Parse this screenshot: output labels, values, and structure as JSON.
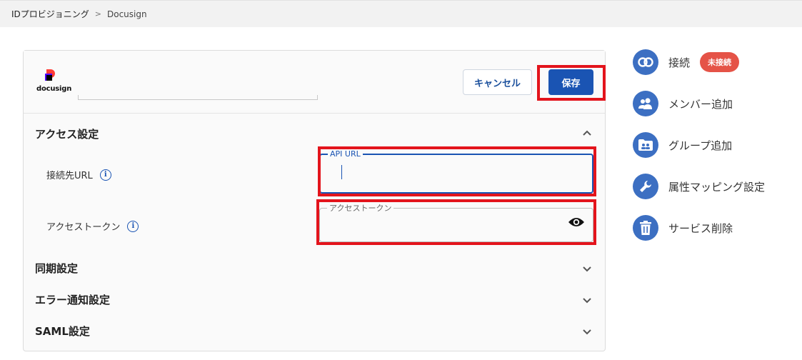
{
  "breadcrumb": {
    "root": "IDプロビジョニング",
    "separator": ">",
    "current": "Docusign"
  },
  "logo": {
    "text": "docusign"
  },
  "header": {
    "cancel_label": "キャンセル",
    "save_label": "保存"
  },
  "access_section": {
    "title": "アクセス設定",
    "url_row": {
      "label": "接続先URL",
      "field_legend": "API URL",
      "value": ""
    },
    "token_row": {
      "label": "アクセストークン",
      "field_legend": "アクセストークン",
      "value": ""
    }
  },
  "collapsed_sections": [
    {
      "title": "同期設定"
    },
    {
      "title": "エラー通知設定"
    },
    {
      "title": "SAML設定"
    }
  ],
  "sidebar": {
    "items": [
      {
        "label": "接続",
        "icon": "link-icon",
        "badge": "未接続"
      },
      {
        "label": "メンバー追加",
        "icon": "users-icon"
      },
      {
        "label": "グループ追加",
        "icon": "group-folder-icon"
      },
      {
        "label": "属性マッピング設定",
        "icon": "wrench-icon"
      },
      {
        "label": "サービス削除",
        "icon": "trash-icon"
      }
    ]
  },
  "colors": {
    "primary": "#1a54b3",
    "icon_bg": "#3c6fc2",
    "highlight": "#e3141c",
    "badge": "#e55347"
  }
}
